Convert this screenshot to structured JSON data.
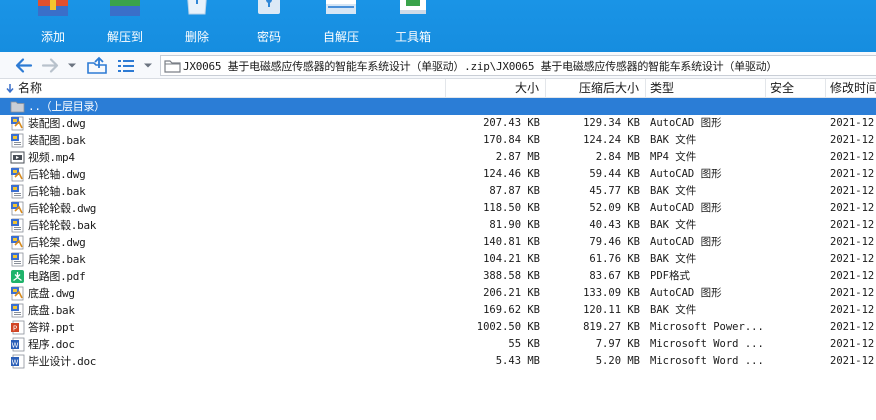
{
  "toolbar": {
    "buttons": [
      {
        "label": "添加",
        "icon": "add-archive-icon"
      },
      {
        "label": "解压到",
        "icon": "extract-to-icon"
      },
      {
        "label": "删除",
        "icon": "recycle-bin-icon"
      },
      {
        "label": "密码",
        "icon": "padlock-icon"
      },
      {
        "label": "自解压",
        "icon": "self-extract-icon"
      },
      {
        "label": "工具箱",
        "icon": "toolbox-icon"
      }
    ],
    "background": "#1a94e6"
  },
  "navbar": {
    "address": "JX0065 基于电磁感应传感器的智能车系统设计（单驱动）.zip\\JX0065 基于电磁感应传感器的智能车系统设计（单驱动）"
  },
  "columns": {
    "name": "名称",
    "size": "大小",
    "packed": "压缩后大小",
    "type": "类型",
    "security": "安全",
    "modified": "修改时间"
  },
  "parent_row": {
    "name": "..（上层目录）"
  },
  "files": [
    {
      "name": "装配图.dwg",
      "size": "207.43 KB",
      "packed": "129.34 KB",
      "type": "AutoCAD 图形",
      "modified": "2021-12-",
      "icon": "dwg-file-icon"
    },
    {
      "name": "装配图.bak",
      "size": "170.84 KB",
      "packed": "124.24 KB",
      "type": "BAK 文件",
      "modified": "2021-12-",
      "icon": "bak-file-icon"
    },
    {
      "name": "视频.mp4",
      "size": "2.87 MB",
      "packed": "2.84 MB",
      "type": "MP4 文件",
      "modified": "2021-12-",
      "icon": "video-file-icon"
    },
    {
      "name": "后轮轴.dwg",
      "size": "124.46 KB",
      "packed": "59.44 KB",
      "type": "AutoCAD 图形",
      "modified": "2021-12-",
      "icon": "dwg-file-icon"
    },
    {
      "name": "后轮轴.bak",
      "size": "87.87 KB",
      "packed": "45.77 KB",
      "type": "BAK 文件",
      "modified": "2021-12-",
      "icon": "bak-file-icon"
    },
    {
      "name": "后轮轮毂.dwg",
      "size": "118.50 KB",
      "packed": "52.09 KB",
      "type": "AutoCAD 图形",
      "modified": "2021-12-",
      "icon": "dwg-file-icon"
    },
    {
      "name": "后轮轮毂.bak",
      "size": "81.90 KB",
      "packed": "40.43 KB",
      "type": "BAK 文件",
      "modified": "2021-12-",
      "icon": "bak-file-icon"
    },
    {
      "name": "后轮架.dwg",
      "size": "140.81 KB",
      "packed": "79.46 KB",
      "type": "AutoCAD 图形",
      "modified": "2021-12-",
      "icon": "dwg-file-icon"
    },
    {
      "name": "后轮架.bak",
      "size": "104.21 KB",
      "packed": "61.76 KB",
      "type": "BAK 文件",
      "modified": "2021-12-",
      "icon": "bak-file-icon"
    },
    {
      "name": "电路图.pdf",
      "size": "388.58 KB",
      "packed": "83.67 KB",
      "type": "PDF格式",
      "modified": "2021-12-",
      "icon": "pdf-file-icon"
    },
    {
      "name": "底盘.dwg",
      "size": "206.21 KB",
      "packed": "133.09 KB",
      "type": "AutoCAD 图形",
      "modified": "2021-12-",
      "icon": "dwg-file-icon"
    },
    {
      "name": "底盘.bak",
      "size": "169.62 KB",
      "packed": "120.11 KB",
      "type": "BAK 文件",
      "modified": "2021-12-",
      "icon": "bak-file-icon"
    },
    {
      "name": "答辩.ppt",
      "size": "1002.50 KB",
      "packed": "819.27 KB",
      "type": "Microsoft Power...",
      "modified": "2021-12-",
      "icon": "ppt-file-icon"
    },
    {
      "name": "程序.doc",
      "size": "55 KB",
      "packed": "7.97 KB",
      "type": "Microsoft Word ...",
      "modified": "2021-12-",
      "icon": "doc-file-icon"
    },
    {
      "name": "毕业设计.doc",
      "size": "5.43 MB",
      "packed": "5.20 MB",
      "type": "Microsoft Word ...",
      "modified": "2021-12-",
      "icon": "doc-file-icon"
    }
  ],
  "colors": {
    "toolbar": "#1a94e6",
    "selection": "#2b7dd6",
    "nav_arrow": "#2d7bd4"
  }
}
